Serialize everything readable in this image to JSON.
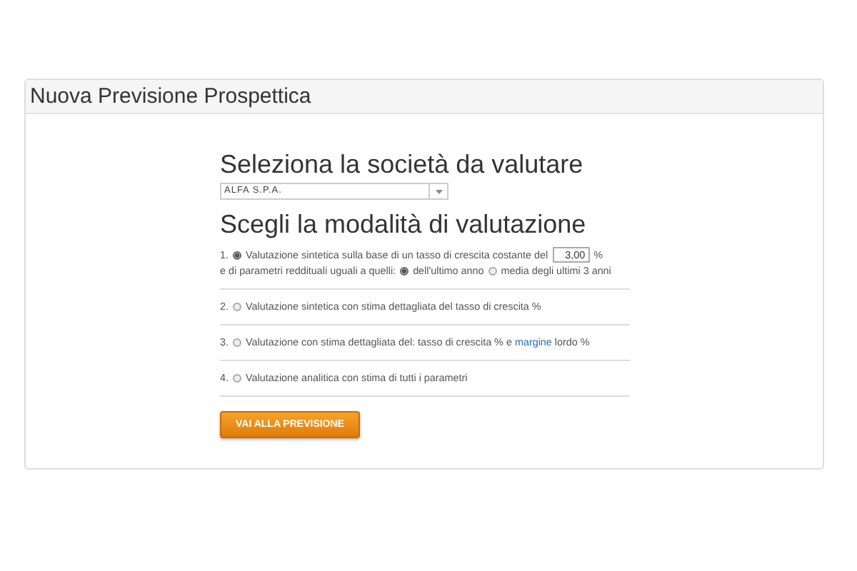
{
  "panel": {
    "title": "Nuova Previsione Prospettica"
  },
  "company": {
    "heading": "Seleziona la società da valutare",
    "value": "ALFA S.P.A."
  },
  "mode": {
    "heading": "Scegli la modalità di valutazione",
    "options": [
      {
        "number": "1.",
        "selected": true,
        "parts": [
          {
            "text": "Valutazione sintetica sulla base di un tasso di crescita costante del",
            "link": false
          }
        ],
        "rate": "3,00",
        "rate_unit": "%",
        "sub_label": "e di parametri reddituali uguali a quelli:",
        "sub_choices": [
          {
            "label": "dell'ultimo anno",
            "selected": true
          },
          {
            "label": "media degli ultimi 3 anni",
            "selected": false
          }
        ]
      },
      {
        "number": "2.",
        "selected": false,
        "parts": [
          {
            "text": "Valutazione sintetica con stima dettagliata del tasso di crescita %",
            "link": false
          }
        ]
      },
      {
        "number": "3.",
        "selected": false,
        "parts": [
          {
            "text": "Valutazione con stima dettagliata del: tasso di crescita % e ",
            "link": false
          },
          {
            "text": "margine",
            "link": true
          },
          {
            "text": " lordo %",
            "link": false
          }
        ]
      },
      {
        "number": "4.",
        "selected": false,
        "parts": [
          {
            "text": "Valutazione analitica con stima di tutti i parametri",
            "link": false
          }
        ]
      }
    ]
  },
  "button": {
    "label": "VAI ALLA PREVISIONE"
  }
}
